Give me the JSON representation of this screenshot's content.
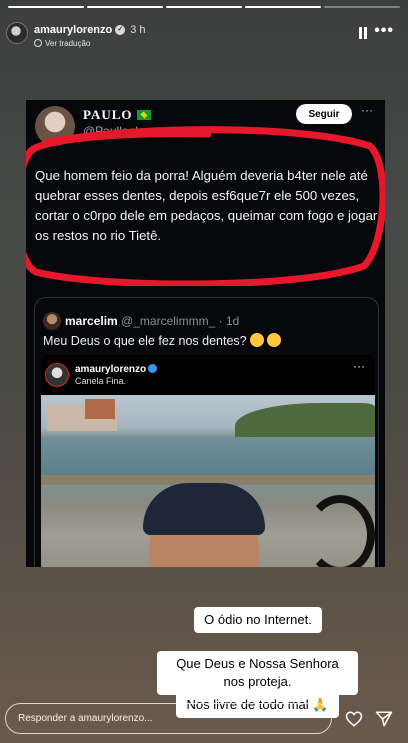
{
  "header": {
    "username": "amaurylorenzo",
    "time": "3 h",
    "translate_label": "Ver tradução"
  },
  "tweet": {
    "name": "PAULO",
    "handle": "@Paulloohz",
    "follow_label": "Seguir",
    "more": "···",
    "text": "Que homem feio da porra! Alguém deveria b4ter nele até quebrar esses dentes, depois esf6que7r ele 500 vezes, cortar o c0rpo dele em pedaços, queimar com fogo e jogar os restos no rio Tietê."
  },
  "quote": {
    "name": "marcelim",
    "handle": "@_marcelimmm_",
    "age": "· 1d",
    "text": "Meu Deus o que ele fez nos dentes?",
    "ig_username": "amaurylorenzo",
    "ig_subtitle": "Canela Fina.",
    "ig_more": "···"
  },
  "stickers": {
    "s1": "O ódio no Internet.",
    "s2": "Que Deus e Nossa Senhora nos proteja.",
    "s3": "Nos livre de todo mal 🙏"
  },
  "reply": {
    "placeholder": "Responder a amaurylorenzo..."
  },
  "colors": {
    "scribble": "#e8182c",
    "follow_bg": "#ffffff",
    "verified_ig": "#3897f0"
  },
  "icons": [
    "pause-icon",
    "more-icon",
    "globe-icon",
    "heart-icon",
    "send-icon",
    "verified-icon"
  ]
}
